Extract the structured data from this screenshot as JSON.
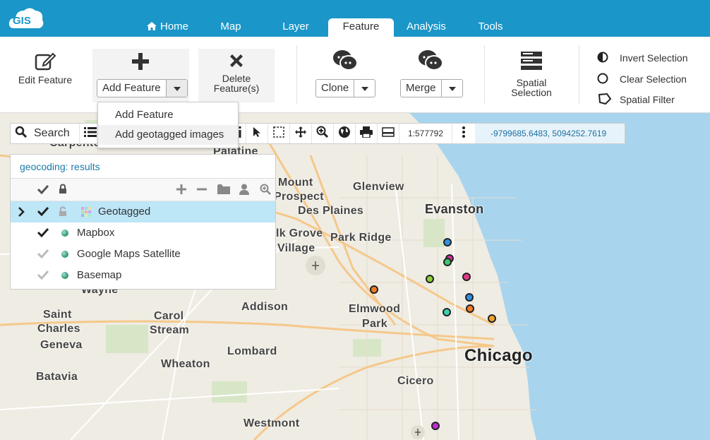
{
  "app": {
    "logo_text": "GIS"
  },
  "tabs": [
    {
      "label": "Home",
      "icon": "home-icon"
    },
    {
      "label": "Map"
    },
    {
      "label": "Layer"
    },
    {
      "label": "Feature",
      "active": true
    },
    {
      "label": "Analysis"
    },
    {
      "label": "Tools"
    }
  ],
  "ribbon": {
    "edit_feature": "Edit Feature",
    "add_feature": "Add Feature",
    "delete_feature_line1": "Delete",
    "delete_feature_line2": "Feature(s)",
    "clone": "Clone",
    "merge": "Merge",
    "spatial_selection_line1": "Spatial",
    "spatial_selection_line2": "Selection",
    "invert_selection": "Invert Selection",
    "clear_selection": "Clear Selection",
    "spatial_filter": "Spatial Filter"
  },
  "dropdown": {
    "items": [
      "Add Feature",
      "Add geotagged images"
    ]
  },
  "toolbar": {
    "search_label": "Search",
    "scale": "1:577792",
    "coordinates": "-9799685.6483, 5094252.7619"
  },
  "layer_panel": {
    "title": "geocoding: results",
    "layers": [
      {
        "name": "Geotagged",
        "selected": true,
        "visible": true
      },
      {
        "name": "Mapbox",
        "visible": true
      },
      {
        "name": "Google Maps Satellite",
        "visible": false
      },
      {
        "name": "Basemap",
        "visible": false
      }
    ]
  },
  "map": {
    "places": [
      "Carpenter",
      "Palatine",
      "Mount",
      "Prospect",
      "Glenview",
      "Des Plaines",
      "Evanston",
      "Elk Grove",
      "Village",
      "Park Ridge",
      "Wayne",
      "Saint",
      "Charles",
      "Geneva",
      "Carol",
      "Stream",
      "Addison",
      "Elmwood",
      "Park",
      "Lombard",
      "Wheaton",
      "Chicago",
      "Batavia",
      "Cicero",
      "Westmont"
    ]
  },
  "colors": {
    "topbar": "#1a96c8",
    "water": "#a8d4ee",
    "land": "#efece3",
    "selection": "#bde6f7"
  }
}
